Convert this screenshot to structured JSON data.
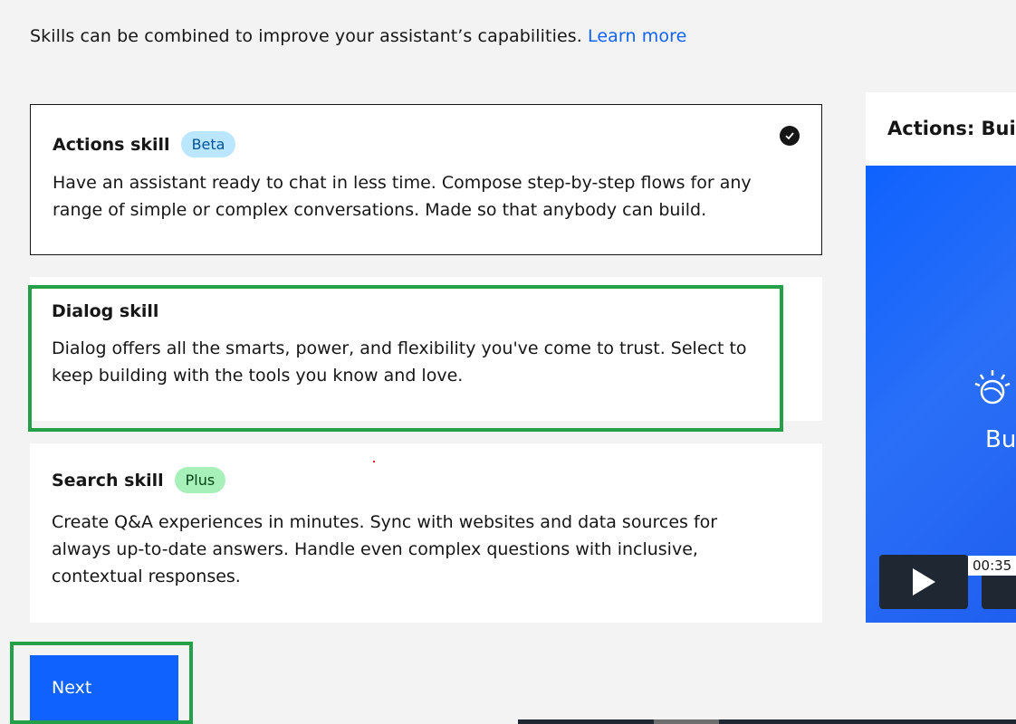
{
  "intro": {
    "text": "Skills can be combined to improve your assistant’s capabilities.",
    "link": "Learn more"
  },
  "cards": {
    "actions": {
      "title": "Actions skill",
      "tag": "Beta",
      "desc": "Have an assistant ready to chat in less time. Compose step-by-step flows for any range of simple or complex conversations. Made so that anybody can build.",
      "selected": true
    },
    "dialog": {
      "title": "Dialog skill",
      "desc": "Dialog offers all the smarts, power, and flexibility you've come to trust. Select to keep building with the tools you know and love."
    },
    "search": {
      "title": "Search skill",
      "tag": "Plus",
      "desc": "Create Q&A experiences in minutes. Sync with websites and data sources for always up-to-date answers. Handle even complex questions with inclusive, contextual responses."
    }
  },
  "next_label": "Next",
  "side": {
    "title": "Actions: Buil",
    "video_text": "Bu",
    "time": "00:35"
  },
  "colors": {
    "accent": "#0f62fe",
    "highlight": "#24a148",
    "beta_tag": "#bae6ff",
    "plus_tag": "#a7f0ba"
  },
  "icons": {
    "check": "checkmark-filled-icon",
    "play": "play-icon",
    "logo": "watson-logo-icon"
  }
}
